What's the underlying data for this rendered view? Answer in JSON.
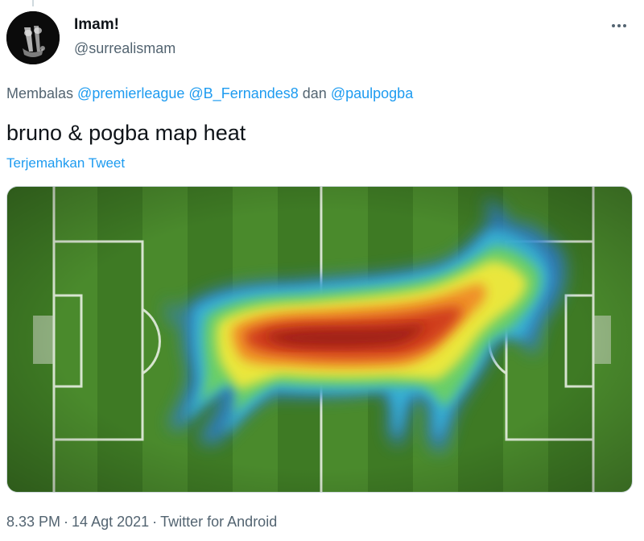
{
  "author": {
    "display_name": "Imam!",
    "handle": "@surrealismam"
  },
  "reply": {
    "prefix": "Membalas",
    "mentions": [
      "@premierleague",
      "@B_Fernandes8",
      "@paulpogba"
    ],
    "conjunction": "dan"
  },
  "tweet": {
    "text": "bruno & pogba map heat",
    "translate_label": "Terjemahkan Tweet"
  },
  "media": {
    "description_icon": "goat-shaped-heatmap-on-football-pitch",
    "pitch_colors": [
      "#4f8f2e",
      "#3f7d25"
    ],
    "heat_colors": [
      "#2f7fd6",
      "#3fb8d8",
      "#6fd46a",
      "#f2ea3a",
      "#f08a28",
      "#c8301e",
      "#9a1f14"
    ]
  },
  "meta": {
    "time": "8.33 PM",
    "separator": "·",
    "date": "14 Agt 2021",
    "source": "Twitter for Android"
  },
  "icons": {
    "more": "more-horizontal-icon",
    "avatar": "guitar-hands-avatar"
  }
}
